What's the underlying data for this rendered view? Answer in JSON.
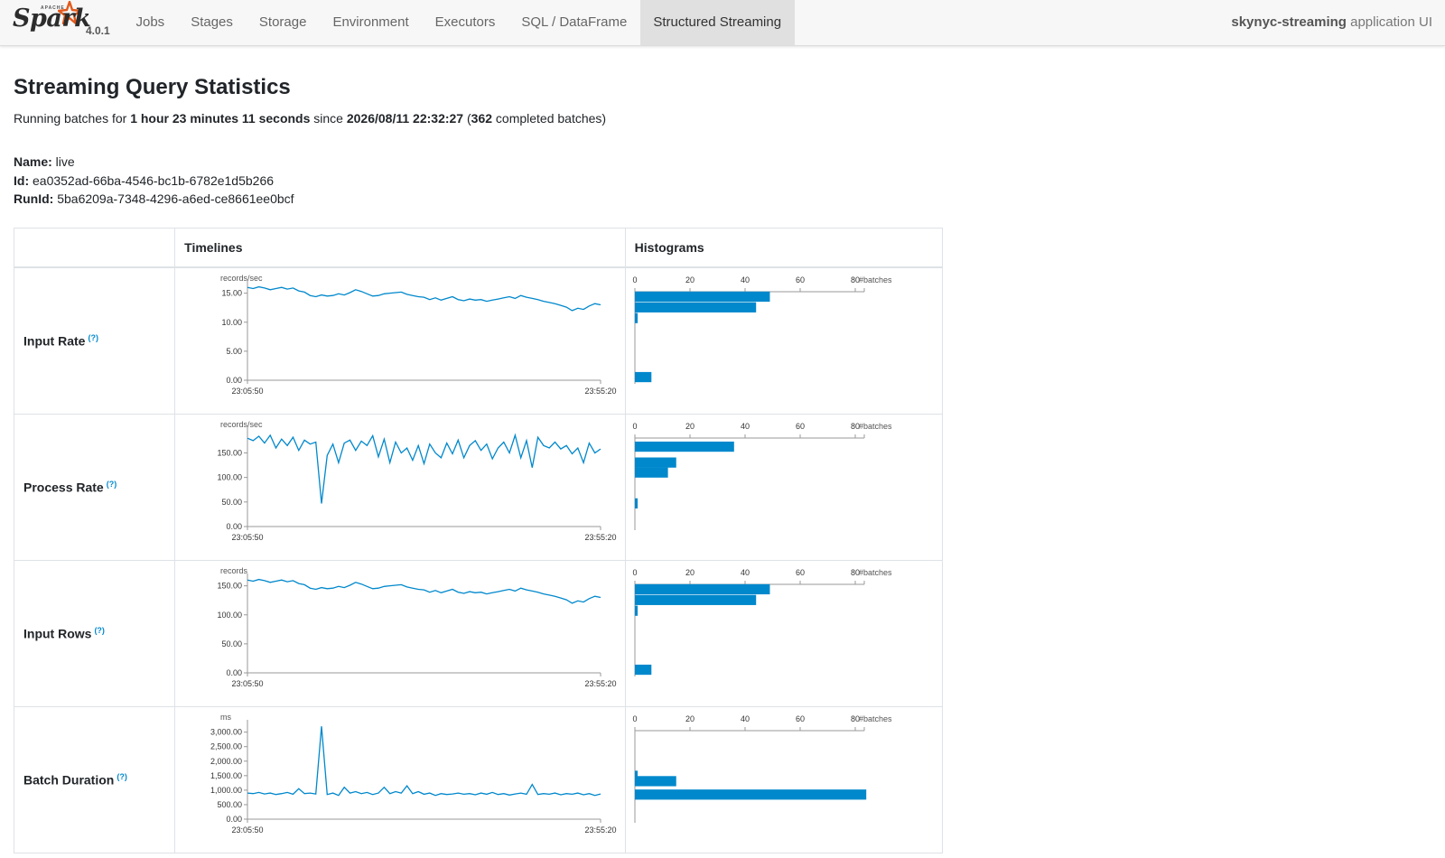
{
  "app": {
    "logo_text": "Spark",
    "logo_apache": "APACHE",
    "version": "4.0.1",
    "title_bold": "skynyc-streaming",
    "title_rest": " application UI"
  },
  "nav": {
    "tabs": [
      "Jobs",
      "Stages",
      "Storage",
      "Environment",
      "Executors",
      "SQL / DataFrame",
      "Structured Streaming"
    ],
    "active": "Structured Streaming"
  },
  "page": {
    "heading": "Streaming Query Statistics",
    "summary_prefix": "Running batches for ",
    "duration": "1 hour 23 minutes 11 seconds",
    "since_text": " since ",
    "start_time": "2026/08/11 22:32:27",
    "open_paren": " (",
    "completed": "362",
    "completed_suffix": " completed batches)",
    "name_label": "Name:",
    "name_value": " live",
    "id_label": "Id:",
    "id_value": " ea0352ad-66ba-4546-bc1b-6782e1d5b266",
    "runid_label": "RunId:",
    "runid_value": " 5ba6209a-7348-4296-a6ed-ce8661ee0bcf"
  },
  "table": {
    "header_timelines": "Timelines",
    "header_histograms": "Histograms",
    "help_mark": "(?)"
  },
  "colors": {
    "series": "#0088cc",
    "axis": "#999999"
  },
  "chart_data": [
    {
      "type": "line",
      "metric": "Input Rate",
      "unit": "records/sec",
      "x_start": "23:05:50",
      "x_end": "23:55:20",
      "ylim": [
        0,
        16.5
      ],
      "yticks": [
        0,
        5,
        10,
        15
      ],
      "ytick_labels": [
        "0.00",
        "5.00",
        "10.00",
        "15.00"
      ],
      "values": [
        16.0,
        15.8,
        16.1,
        15.9,
        15.6,
        15.8,
        16.0,
        15.7,
        15.9,
        15.4,
        15.2,
        14.6,
        14.4,
        14.7,
        14.5,
        14.6,
        14.9,
        14.7,
        15.1,
        15.6,
        15.3,
        14.9,
        14.5,
        14.6,
        14.9,
        15.0,
        15.1,
        15.2,
        14.8,
        14.6,
        14.4,
        14.3,
        13.9,
        14.2,
        13.8,
        14.1,
        14.4,
        13.9,
        13.7,
        14.0,
        13.8,
        13.9,
        13.6,
        13.8,
        14.0,
        14.2,
        14.4,
        14.1,
        14.6,
        14.3,
        14.1,
        13.9,
        13.6,
        13.4,
        13.2,
        12.9,
        12.6,
        12.0,
        12.4,
        12.2,
        12.8,
        13.2,
        13.0
      ],
      "hist_axis_label": "#batches",
      "hist_xticks": [
        0,
        20,
        40,
        60,
        80
      ],
      "hist_bins": [
        {
          "value": 49,
          "bin": 15.5
        },
        {
          "value": 44,
          "bin": 13.5
        },
        {
          "value": 1,
          "bin": 11.5
        },
        {
          "value": 6,
          "bin": 0.5
        }
      ]
    },
    {
      "type": "line",
      "metric": "Process Rate",
      "unit": "records/sec",
      "x_start": "23:05:50",
      "x_end": "23:55:20",
      "ylim": [
        0,
        195
      ],
      "yticks": [
        0,
        50,
        100,
        150
      ],
      "ytick_labels": [
        "0.00",
        "50.00",
        "100.00",
        "150.00"
      ],
      "values": [
        180,
        175,
        184,
        170,
        186,
        160,
        178,
        165,
        182,
        155,
        176,
        168,
        172,
        47,
        145,
        168,
        130,
        170,
        176,
        155,
        174,
        165,
        185,
        142,
        178,
        130,
        172,
        150,
        160,
        135,
        165,
        128,
        168,
        150,
        140,
        170,
        148,
        176,
        140,
        165,
        175,
        155,
        168,
        138,
        160,
        172,
        150,
        186,
        140,
        175,
        120,
        182,
        165,
        160,
        172,
        158,
        165,
        148,
        160,
        130,
        170,
        150,
        158
      ],
      "hist_axis_label": "#batches",
      "hist_xticks": [
        0,
        20,
        40,
        60,
        80
      ],
      "hist_bins": [
        {
          "value": 36,
          "bin": 175
        },
        {
          "value": 15,
          "bin": 140
        },
        {
          "value": 12,
          "bin": 118
        },
        {
          "value": 1,
          "bin": 50
        }
      ]
    },
    {
      "type": "line",
      "metric": "Input Rows",
      "unit": "records",
      "x_start": "23:05:50",
      "x_end": "23:55:20",
      "ylim": [
        0,
        165
      ],
      "yticks": [
        0,
        50,
        100,
        150
      ],
      "ytick_labels": [
        "0.00",
        "50.00",
        "100.00",
        "150.00"
      ],
      "values": [
        160,
        158,
        161,
        159,
        156,
        158,
        160,
        157,
        159,
        154,
        152,
        146,
        144,
        147,
        145,
        146,
        149,
        147,
        151,
        156,
        153,
        149,
        145,
        146,
        149,
        150,
        151,
        152,
        148,
        146,
        144,
        143,
        139,
        142,
        138,
        141,
        144,
        139,
        137,
        140,
        138,
        139,
        136,
        138,
        140,
        142,
        144,
        141,
        146,
        143,
        141,
        139,
        136,
        134,
        132,
        129,
        126,
        120,
        124,
        122,
        128,
        132,
        130
      ],
      "hist_axis_label": "#batches",
      "hist_xticks": [
        0,
        20,
        40,
        60,
        80
      ],
      "hist_bins": [
        {
          "value": 49,
          "bin": 155
        },
        {
          "value": 44,
          "bin": 135
        },
        {
          "value": 1,
          "bin": 115
        },
        {
          "value": 6,
          "bin": 5
        }
      ]
    },
    {
      "type": "line",
      "metric": "Batch Duration",
      "unit": "ms",
      "x_start": "23:05:50",
      "x_end": "23:55:20",
      "ylim": [
        0,
        3300
      ],
      "yticks": [
        0,
        500,
        1000,
        1500,
        2000,
        2500,
        3000
      ],
      "ytick_labels": [
        "0.00",
        "500.00",
        "1,000.00",
        "1,500.00",
        "2,000.00",
        "2,500.00",
        "3,000.00"
      ],
      "values": [
        900,
        880,
        920,
        870,
        900,
        850,
        880,
        920,
        860,
        1050,
        880,
        900,
        870,
        3200,
        850,
        900,
        820,
        1100,
        900,
        950,
        880,
        920,
        850,
        900,
        1100,
        880,
        950,
        900,
        1150,
        880,
        950,
        860,
        900,
        820,
        880,
        850,
        870,
        900,
        860,
        880,
        840,
        900,
        860,
        920,
        850,
        880,
        830,
        870,
        900,
        860,
        1200,
        850,
        880,
        860,
        900,
        840,
        880,
        860,
        900,
        840,
        880,
        820,
        870
      ],
      "hist_axis_label": "#batches",
      "hist_xticks": [
        0,
        20,
        40,
        60,
        80
      ],
      "hist_bins": [
        {
          "value": 1,
          "bin": 1600
        },
        {
          "value": 15,
          "bin": 1400
        },
        {
          "value": 84,
          "bin": 900
        }
      ]
    }
  ]
}
